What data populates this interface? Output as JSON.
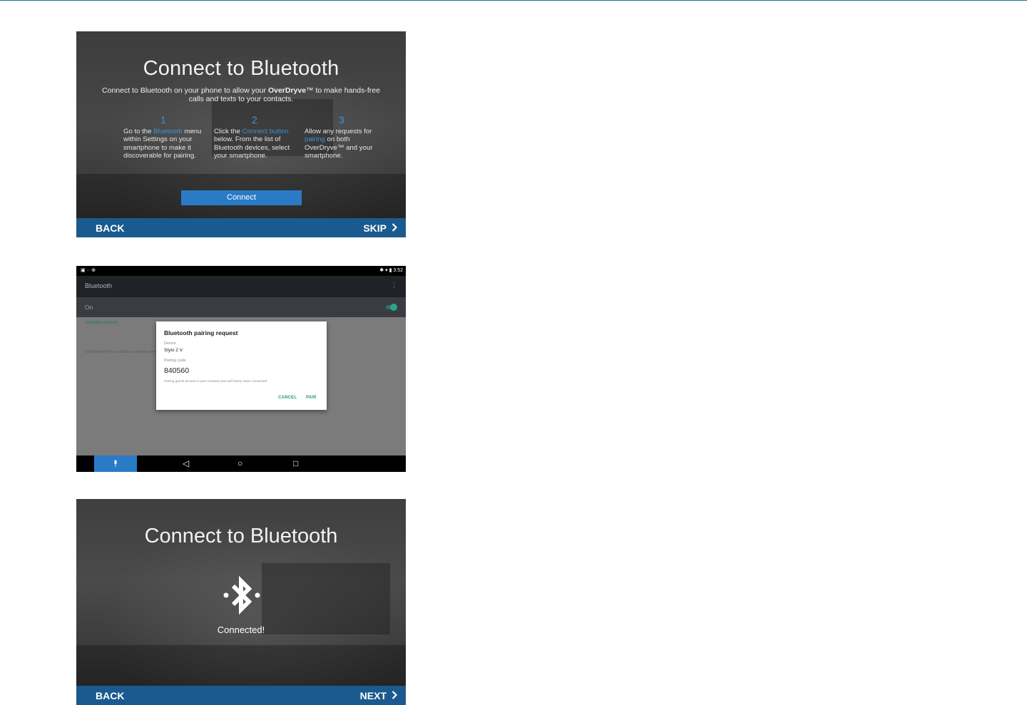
{
  "panel1": {
    "title": "Connect to Bluetooth",
    "subtitle_before": "Connect to Bluetooth on your phone to allow your ",
    "subtitle_brand": "OverDryve",
    "subtitle_after": "™ to make hands-free calls and texts to your contacts.",
    "steps": [
      {
        "number": "1",
        "pre": "Go to the ",
        "highlight": "Bluetooth",
        "post": " menu within Settings on your smartphone to make it discoverable for pairing."
      },
      {
        "number": "2",
        "pre": "Click the ",
        "highlight": "Connect button",
        "post": " below. From the list of Bluetooth devices, select your smartphone."
      },
      {
        "number": "3",
        "pre": "Allow any requests for ",
        "highlight": "pairing",
        "post": " on both OverDryve™ and your smartphone."
      }
    ],
    "connect_label": "Connect",
    "back_label": "BACK",
    "skip_label": "SKIP",
    "accent_color": "#2a7bc6",
    "navbar_color": "#1a5a8e"
  },
  "panel2": {
    "status_left": "▣ ·· ⊕",
    "status_right": "✱ ▾ ▮ 3:52",
    "screen_title": "Bluetooth",
    "menu_glyph": "⋮",
    "toggle_label": "On",
    "available_devices": "Available devices",
    "visible_text": "OverDryve 8 Pro is visible to nearby devices",
    "dialog": {
      "title": "Bluetooth pairing request",
      "device_label": "Device",
      "device_value": "Stylo 2 V",
      "code_label": "Pairing code",
      "code_value": "840560",
      "note": "Pairing grants access to your contacts and call history when connected",
      "cancel_label": "CANCEL",
      "pair_label": "PAIR"
    },
    "mic_icon": "🎙",
    "back_icon": "◁",
    "home_icon": "○",
    "recents_icon": "□",
    "dialog_accent": "#1d9a85"
  },
  "panel3": {
    "title": "Connect to Bluetooth",
    "status": "Connected!",
    "icon": "bluetooth-icon",
    "back_label": "BACK",
    "next_label": "NEXT"
  }
}
